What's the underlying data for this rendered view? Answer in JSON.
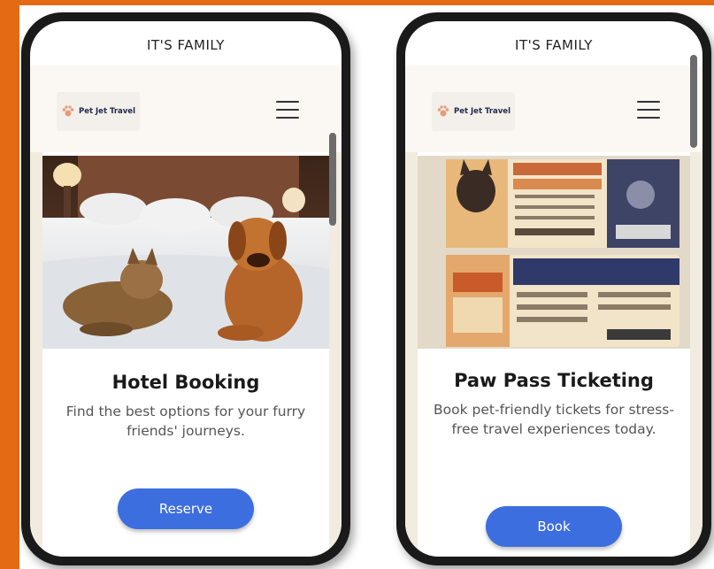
{
  "phone_left": {
    "top_title": "IT'S FAMILY",
    "logo_text": "Pet Jet Travel",
    "card_title": "Hotel Booking",
    "card_description": "Find the best options for your furry friends' journeys.",
    "button_label": "Reserve"
  },
  "phone_right": {
    "top_title": "IT'S FAMILY",
    "logo_text": "Pet Jet Travel",
    "card_title": "Paw Pass Ticketing",
    "card_description": "Book pet-friendly tickets for stress-free travel experiences today.",
    "button_label": "Book"
  },
  "colors": {
    "accent_orange": "#e46b14",
    "button_blue": "#3d6ee0",
    "phone_frame": "#1a1a1a"
  }
}
